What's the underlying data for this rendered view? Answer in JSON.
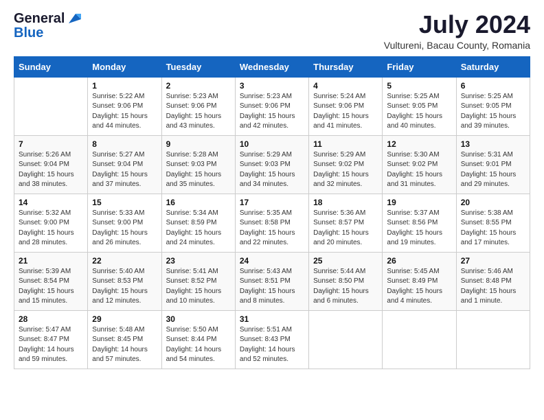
{
  "logo": {
    "general": "General",
    "blue": "Blue"
  },
  "title": "July 2024",
  "location": "Vultureni, Bacau County, Romania",
  "days_of_week": [
    "Sunday",
    "Monday",
    "Tuesday",
    "Wednesday",
    "Thursday",
    "Friday",
    "Saturday"
  ],
  "weeks": [
    [
      {
        "day": "",
        "info": ""
      },
      {
        "day": "1",
        "info": "Sunrise: 5:22 AM\nSunset: 9:06 PM\nDaylight: 15 hours\nand 44 minutes."
      },
      {
        "day": "2",
        "info": "Sunrise: 5:23 AM\nSunset: 9:06 PM\nDaylight: 15 hours\nand 43 minutes."
      },
      {
        "day": "3",
        "info": "Sunrise: 5:23 AM\nSunset: 9:06 PM\nDaylight: 15 hours\nand 42 minutes."
      },
      {
        "day": "4",
        "info": "Sunrise: 5:24 AM\nSunset: 9:06 PM\nDaylight: 15 hours\nand 41 minutes."
      },
      {
        "day": "5",
        "info": "Sunrise: 5:25 AM\nSunset: 9:05 PM\nDaylight: 15 hours\nand 40 minutes."
      },
      {
        "day": "6",
        "info": "Sunrise: 5:25 AM\nSunset: 9:05 PM\nDaylight: 15 hours\nand 39 minutes."
      }
    ],
    [
      {
        "day": "7",
        "info": "Sunrise: 5:26 AM\nSunset: 9:04 PM\nDaylight: 15 hours\nand 38 minutes."
      },
      {
        "day": "8",
        "info": "Sunrise: 5:27 AM\nSunset: 9:04 PM\nDaylight: 15 hours\nand 37 minutes."
      },
      {
        "day": "9",
        "info": "Sunrise: 5:28 AM\nSunset: 9:03 PM\nDaylight: 15 hours\nand 35 minutes."
      },
      {
        "day": "10",
        "info": "Sunrise: 5:29 AM\nSunset: 9:03 PM\nDaylight: 15 hours\nand 34 minutes."
      },
      {
        "day": "11",
        "info": "Sunrise: 5:29 AM\nSunset: 9:02 PM\nDaylight: 15 hours\nand 32 minutes."
      },
      {
        "day": "12",
        "info": "Sunrise: 5:30 AM\nSunset: 9:02 PM\nDaylight: 15 hours\nand 31 minutes."
      },
      {
        "day": "13",
        "info": "Sunrise: 5:31 AM\nSunset: 9:01 PM\nDaylight: 15 hours\nand 29 minutes."
      }
    ],
    [
      {
        "day": "14",
        "info": "Sunrise: 5:32 AM\nSunset: 9:00 PM\nDaylight: 15 hours\nand 28 minutes."
      },
      {
        "day": "15",
        "info": "Sunrise: 5:33 AM\nSunset: 9:00 PM\nDaylight: 15 hours\nand 26 minutes."
      },
      {
        "day": "16",
        "info": "Sunrise: 5:34 AM\nSunset: 8:59 PM\nDaylight: 15 hours\nand 24 minutes."
      },
      {
        "day": "17",
        "info": "Sunrise: 5:35 AM\nSunset: 8:58 PM\nDaylight: 15 hours\nand 22 minutes."
      },
      {
        "day": "18",
        "info": "Sunrise: 5:36 AM\nSunset: 8:57 PM\nDaylight: 15 hours\nand 20 minutes."
      },
      {
        "day": "19",
        "info": "Sunrise: 5:37 AM\nSunset: 8:56 PM\nDaylight: 15 hours\nand 19 minutes."
      },
      {
        "day": "20",
        "info": "Sunrise: 5:38 AM\nSunset: 8:55 PM\nDaylight: 15 hours\nand 17 minutes."
      }
    ],
    [
      {
        "day": "21",
        "info": "Sunrise: 5:39 AM\nSunset: 8:54 PM\nDaylight: 15 hours\nand 15 minutes."
      },
      {
        "day": "22",
        "info": "Sunrise: 5:40 AM\nSunset: 8:53 PM\nDaylight: 15 hours\nand 12 minutes."
      },
      {
        "day": "23",
        "info": "Sunrise: 5:41 AM\nSunset: 8:52 PM\nDaylight: 15 hours\nand 10 minutes."
      },
      {
        "day": "24",
        "info": "Sunrise: 5:43 AM\nSunset: 8:51 PM\nDaylight: 15 hours\nand 8 minutes."
      },
      {
        "day": "25",
        "info": "Sunrise: 5:44 AM\nSunset: 8:50 PM\nDaylight: 15 hours\nand 6 minutes."
      },
      {
        "day": "26",
        "info": "Sunrise: 5:45 AM\nSunset: 8:49 PM\nDaylight: 15 hours\nand 4 minutes."
      },
      {
        "day": "27",
        "info": "Sunrise: 5:46 AM\nSunset: 8:48 PM\nDaylight: 15 hours\nand 1 minute."
      }
    ],
    [
      {
        "day": "28",
        "info": "Sunrise: 5:47 AM\nSunset: 8:47 PM\nDaylight: 14 hours\nand 59 minutes."
      },
      {
        "day": "29",
        "info": "Sunrise: 5:48 AM\nSunset: 8:45 PM\nDaylight: 14 hours\nand 57 minutes."
      },
      {
        "day": "30",
        "info": "Sunrise: 5:50 AM\nSunset: 8:44 PM\nDaylight: 14 hours\nand 54 minutes."
      },
      {
        "day": "31",
        "info": "Sunrise: 5:51 AM\nSunset: 8:43 PM\nDaylight: 14 hours\nand 52 minutes."
      },
      {
        "day": "",
        "info": ""
      },
      {
        "day": "",
        "info": ""
      },
      {
        "day": "",
        "info": ""
      }
    ]
  ]
}
